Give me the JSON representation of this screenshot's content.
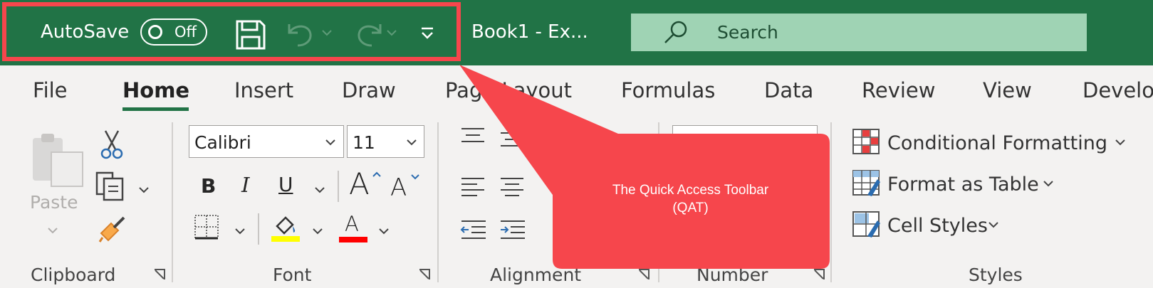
{
  "titlebar": {
    "autosave_label": "AutoSave",
    "autosave_state": "Off",
    "book_title": "Book1  -  Ex...",
    "search_placeholder": "Search"
  },
  "tabs": [
    "File",
    "Home",
    "Insert",
    "Draw",
    "Page Layout",
    "Formulas",
    "Data",
    "Review",
    "View",
    "Develo"
  ],
  "active_tab": "Home",
  "clipboard": {
    "paste_label": "Paste",
    "group_label": "Clipboard"
  },
  "font": {
    "font_name": "Calibri",
    "font_size": "11",
    "bold": "B",
    "italic": "I",
    "underline": "U",
    "grow": "A",
    "shrink": "A",
    "font_color": "A",
    "group_label": "Font"
  },
  "alignment": {
    "group_label": "Alignment"
  },
  "number": {
    "group_label": "Number"
  },
  "styles": {
    "conditional_formatting": "Conditional Formatting",
    "format_as_table": "Format as Table",
    "cell_styles": "Cell Styles",
    "group_label": "Styles"
  },
  "callout": {
    "line1": "The Quick Access Toolbar",
    "line2": "(QAT)"
  },
  "colors": {
    "excel_green": "#217346",
    "highlight_red": "#f6464c",
    "search_bg": "#9fd3b4",
    "ribbon_bg": "#f3f2f1"
  }
}
